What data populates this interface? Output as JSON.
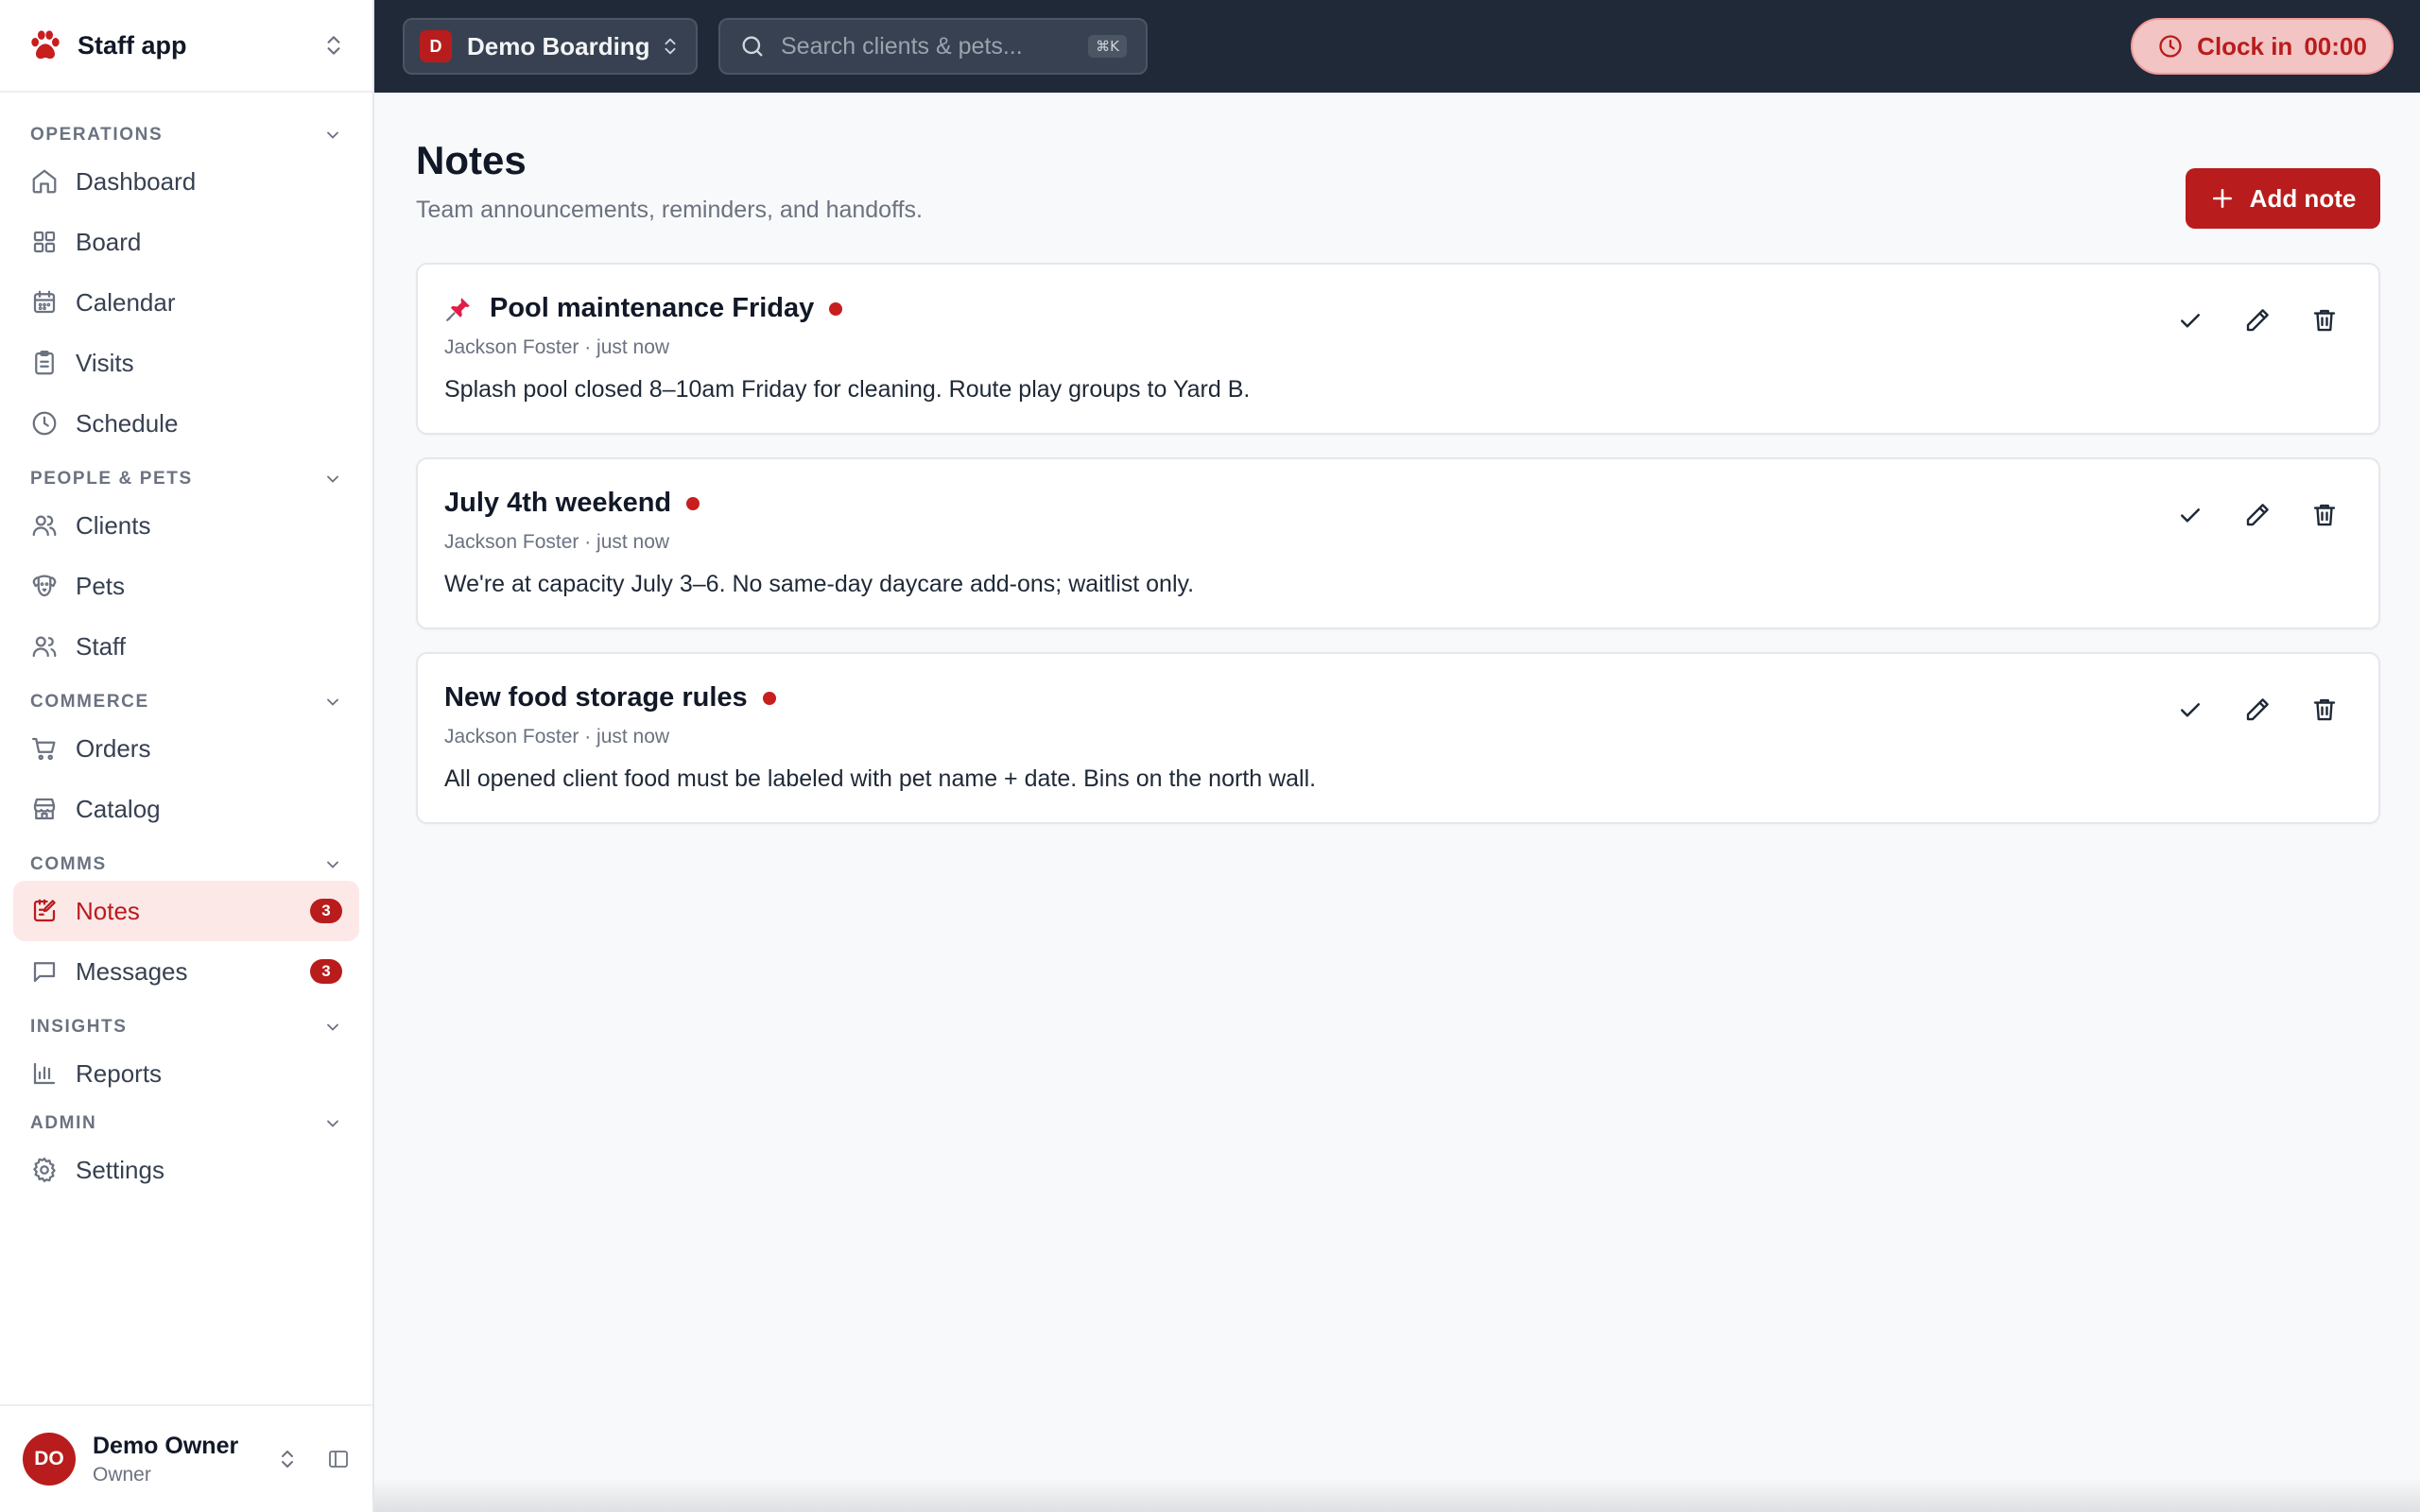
{
  "brand": {
    "name": "Staff app"
  },
  "sidebar": {
    "sections": {
      "operations": {
        "title": "OPERATIONS",
        "items": {
          "dashboard": "Dashboard",
          "board": "Board",
          "calendar": "Calendar",
          "visits": "Visits",
          "schedule": "Schedule"
        }
      },
      "people": {
        "title": "PEOPLE & PETS",
        "items": {
          "clients": "Clients",
          "pets": "Pets",
          "staff": "Staff"
        }
      },
      "commerce": {
        "title": "COMMERCE",
        "items": {
          "orders": "Orders",
          "catalog": "Catalog"
        }
      },
      "comms": {
        "title": "COMMS",
        "items": {
          "notes": "Notes",
          "notes_badge": "3",
          "messages": "Messages",
          "messages_badge": "3"
        }
      },
      "insights": {
        "title": "INSIGHTS",
        "items": {
          "reports": "Reports"
        }
      },
      "admin": {
        "title": "ADMIN",
        "items": {
          "settings": "Settings"
        }
      }
    },
    "active_item": "Notes"
  },
  "user": {
    "initials": "DO",
    "name": "Demo Owner",
    "role": "Owner"
  },
  "topbar": {
    "org_initial": "D",
    "org_name": "Demo Boarding",
    "search_placeholder": "Search clients & pets...",
    "search_shortcut": "⌘K",
    "clock_label": "Clock in",
    "clock_time": "00:00"
  },
  "page": {
    "title": "Notes",
    "subtitle": "Team announcements, reminders, and handoffs.",
    "add_label": "Add note"
  },
  "notes": [
    {
      "title": "Pool maintenance Friday",
      "pinned": true,
      "author": "Jackson Foster",
      "time": "just now",
      "meta": "Jackson Foster · just now",
      "body": "Splash pool closed 8–10am Friday for cleaning. Route play groups to Yard B."
    },
    {
      "title": "July 4th weekend",
      "pinned": false,
      "author": "Jackson Foster",
      "time": "just now",
      "meta": "Jackson Foster · just now",
      "body": "We're at capacity July 3–6. No same-day daycare add-ons; waitlist only."
    },
    {
      "title": "New food storage rules",
      "pinned": false,
      "author": "Jackson Foster",
      "time": "just now",
      "meta": "Jackson Foster · just now",
      "body": "All opened client food must be labeled with pet name + date. Bins on the north wall."
    }
  ],
  "colors": {
    "accent": "#b91c1c",
    "active_bg": "#fde8e8",
    "topbar": "#1f2937",
    "unread_dot": "#c81e1e"
  },
  "icons": [
    "paw-icon",
    "chevrons-updown-icon",
    "chevron-down-icon",
    "home-icon",
    "grid-icon",
    "calendar-icon",
    "clipboard-icon",
    "clock-icon",
    "users-icon",
    "dog-icon",
    "user-group-icon",
    "cart-icon",
    "store-icon",
    "note-edit-icon",
    "message-icon",
    "bar-chart-icon",
    "gear-icon",
    "sidebar-toggle-icon",
    "search-icon",
    "plus-icon",
    "pin-icon",
    "check-icon",
    "pencil-icon",
    "trash-icon"
  ]
}
